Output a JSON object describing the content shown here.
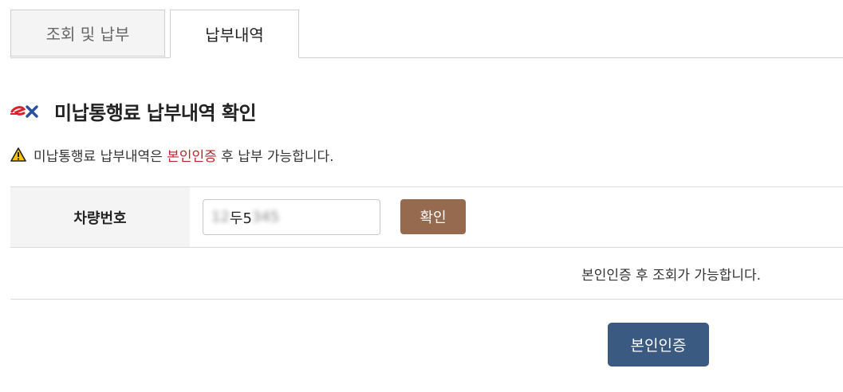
{
  "tabs": [
    {
      "label": "조회 및 납부",
      "active": false
    },
    {
      "label": "납부내역",
      "active": true
    }
  ],
  "heading": {
    "logo_icon": "ex-logo-icon",
    "title": "미납통행료 납부내역 확인"
  },
  "notice": {
    "icon": "warning-icon",
    "text_before": "미납통행료 납부내역은 ",
    "highlight": "본인인증",
    "text_after": " 후 납부 가능합니다.",
    "highlight_color": "#b3282d"
  },
  "form": {
    "plate_label": "차량번호",
    "plate_value": {
      "prefix": "12",
      "middle": "두5",
      "suffix": "345"
    },
    "confirm_label": "확인",
    "auth_message": "본인인증 후 조회가 가능합니다.",
    "auth_button_label": "본인인증"
  },
  "colors": {
    "confirm_button": "#956a4f",
    "auth_button": "#3b5a82",
    "logo_red": "#d9252a",
    "logo_blue": "#2a4f9c"
  }
}
